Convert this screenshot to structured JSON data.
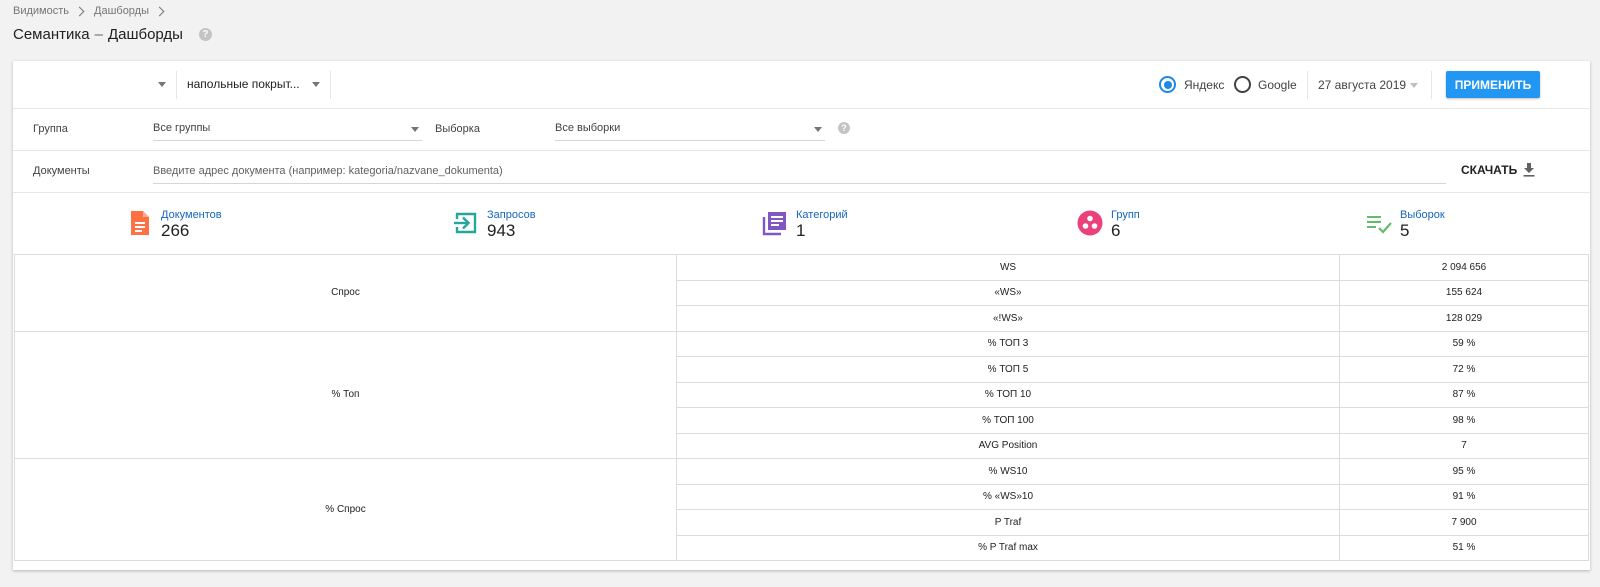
{
  "breadcrumb": [
    "Видимость",
    "Дашборды"
  ],
  "page": {
    "title": "Семантика",
    "subtitle": "Дашборды",
    "help": "?"
  },
  "filters": {
    "query_select": "напольные покрыт...",
    "search_engines": [
      {
        "label": "Яндекс",
        "selected": true
      },
      {
        "label": "Google",
        "selected": false
      }
    ],
    "date": "27 августа 2019",
    "apply_label": "ПРИМЕНИТЬ",
    "group_label": "Группа",
    "group_value": "Все группы",
    "sample_label": "Выборка",
    "sample_value": "Все выборки",
    "help": "?",
    "documents_label": "Документы",
    "documents_placeholder": "Введите адрес документа (например: kategoria/nazvane_dokumenta)",
    "download_label": "СКАЧАТЬ"
  },
  "stats": [
    {
      "label": "Документов",
      "value": "266",
      "icon": "document-icon",
      "color": "#ff7043"
    },
    {
      "label": "Запросов",
      "value": "943",
      "icon": "login-arrow-icon",
      "color": "#26a69a"
    },
    {
      "label": "Категорий",
      "value": "1",
      "icon": "library-books-icon",
      "color": "#7e57c2"
    },
    {
      "label": "Групп",
      "value": "6",
      "icon": "group-circles-icon",
      "color": "#ec407a"
    },
    {
      "label": "Выборок",
      "value": "5",
      "icon": "playlist-check-icon",
      "color": "#66bb6a"
    }
  ],
  "table": [
    {
      "group": "Спрос",
      "rows": [
        {
          "metric": "WS",
          "value": "2 094 656"
        },
        {
          "metric": "«WS»",
          "value": "155 624"
        },
        {
          "metric": "«!WS»",
          "value": "128 029"
        }
      ]
    },
    {
      "group": "% Топ",
      "rows": [
        {
          "metric": "% ТОП 3",
          "value": "59 %"
        },
        {
          "metric": "% ТОП 5",
          "value": "72 %"
        },
        {
          "metric": "% ТОП 10",
          "value": "87 %"
        },
        {
          "metric": "% ТОП 100",
          "value": "98 %"
        },
        {
          "metric": "AVG Position",
          "value": "7"
        }
      ]
    },
    {
      "group": "% Спрос",
      "rows": [
        {
          "metric": "% WS10",
          "value": "95 %"
        },
        {
          "metric": "% «WS»10",
          "value": "91 %"
        },
        {
          "metric": "P Traf",
          "value": "7 900"
        },
        {
          "metric": "% P Traf max",
          "value": "51 %"
        }
      ]
    }
  ]
}
